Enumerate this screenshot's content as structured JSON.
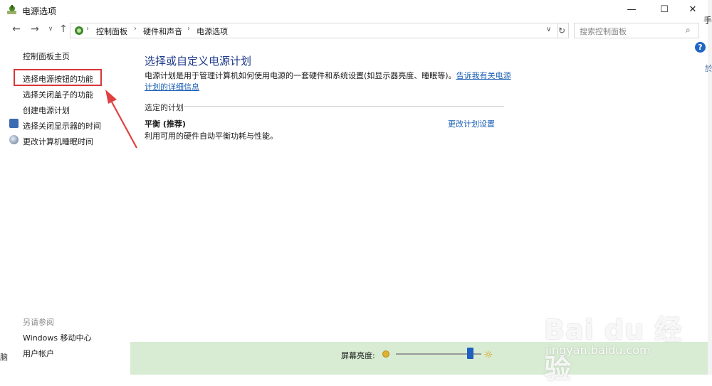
{
  "window": {
    "title": "电源选项",
    "caption": {
      "minimize": "—",
      "maximize": "☐",
      "close": "✕"
    }
  },
  "nav": {
    "back_icon": "←",
    "forward_icon": "→",
    "dropdown_icon": "∨",
    "up_icon": "↑",
    "breadcrumbs": [
      "控制面板",
      "硬件和声音",
      "电源选项"
    ],
    "separator": "›",
    "address_dropdown": "∨",
    "refresh_icon": "↻",
    "search_placeholder": "搜索控制面板",
    "search_icon": "⌕"
  },
  "left_pane": {
    "home": "控制面板主页",
    "links": [
      "选择电源按钮的功能",
      "选择关闭盖子的功能",
      "创建电源计划",
      "选择关闭显示器的时间",
      "更改计算机睡眠时间"
    ],
    "see_also_heading": "另请参阅",
    "see_also_links": [
      "Windows 移动中心",
      "用户帐户"
    ]
  },
  "main": {
    "title": "选择或自定义电源计划",
    "description": "电源计划是用于管理计算机如何使用电源的一套硬件和系统设置(如显示器亮度、睡眠等)。",
    "description_link": "告诉我有关电源计划的详细信息",
    "section_label": "选定的计划",
    "plan": {
      "name": "平衡 (推荐)",
      "description": "利用可用的硬件自动平衡功耗与性能。",
      "change_link": "更改计划设置"
    }
  },
  "bottom": {
    "brightness_label": "屏幕亮度:",
    "brightness_level": 0.87
  },
  "side": {
    "help_icon": "?",
    "edge_text": "手",
    "edge_text2": "於",
    "left_edge": "脑"
  },
  "watermark": {
    "logo": "Bai du 经验",
    "url": "jingyan.baidu.com"
  },
  "colors": {
    "title_blue": "#1e3a8a",
    "link_blue": "#1a5fb4",
    "highlight_red": "#d7373b",
    "brightness_bar_bg": "#d7ecd2"
  }
}
